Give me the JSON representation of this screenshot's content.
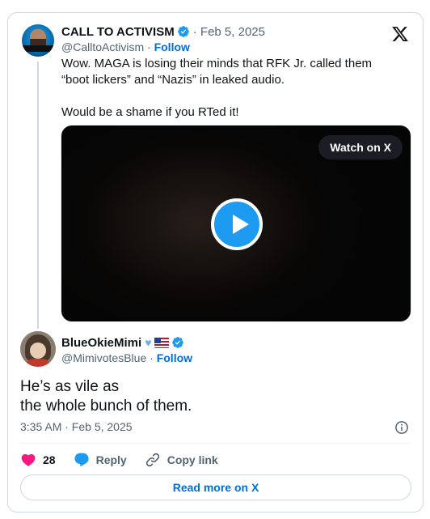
{
  "quoted_tweet": {
    "author_name": "CALL TO ACTIVISM",
    "date": "Feb 5, 2025",
    "handle": "@CalltoActivism",
    "follow_label": "Follow",
    "text_lines": [
      "Wow. MAGA is losing their minds that RFK Jr. called them “boot lickers” and “Nazis” in leaked audio.",
      "Would be a shame if you RTed it!"
    ],
    "media": {
      "watch_label": "Watch on X"
    }
  },
  "tweet": {
    "author_name": "BlueOkieMimi",
    "handle": "@MimivotesBlue",
    "follow_label": "Follow",
    "text_line1": "He’s as vile as",
    "text_line2": "the whole bunch of them.",
    "timestamp": "3:35 AM · Feb 5, 2025",
    "likes": "28",
    "reply_label": "Reply",
    "copy_label": "Copy link"
  },
  "read_more_label": "Read more on X",
  "colors": {
    "accent": "#1d9bf0",
    "like": "#f91880",
    "link": "#006fd6"
  }
}
